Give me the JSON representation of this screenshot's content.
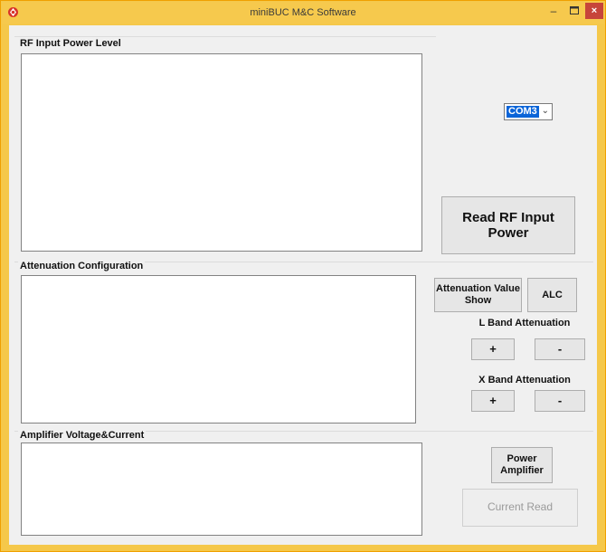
{
  "window": {
    "title": "miniBUC M&C Software",
    "minimize": "–",
    "maximize": "▫",
    "close": "×",
    "accent_color": "#f6c94d"
  },
  "groups": {
    "rf_input": {
      "label": "RF Input Power Level"
    },
    "attenuation": {
      "label": "Attenuation Configuration"
    },
    "amplifier": {
      "label": "Amplifier Voltage&Current"
    }
  },
  "com_port": {
    "selected": "COM3",
    "arrow": "⌄"
  },
  "buttons": {
    "read_rf": "Read RF Input Power",
    "attenuation_show": "Attenuation Value Show",
    "alc": "ALC",
    "l_band_plus": "+",
    "l_band_minus": "-",
    "x_band_plus": "+",
    "x_band_minus": "-",
    "power_amplifier": "Power Amplifier",
    "current_read": "Current Read"
  },
  "labels": {
    "l_band": "L Band Attenuation",
    "x_band": "X Band Attenuation"
  }
}
